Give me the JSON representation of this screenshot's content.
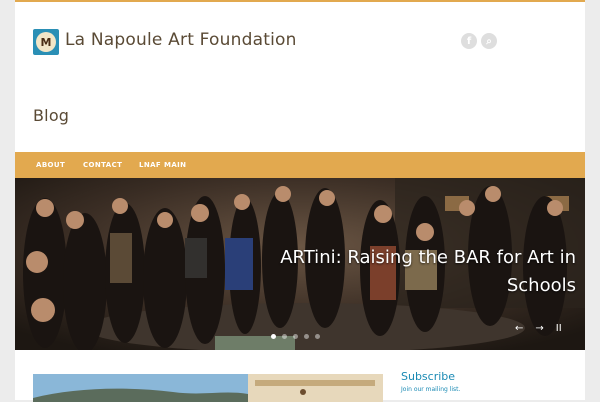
{
  "site": {
    "title": "La Napoule Art Foundation",
    "logo_letter": "M"
  },
  "header": {
    "page_heading": "Blog",
    "social_icons": [
      "facebook-icon",
      "search-icon"
    ]
  },
  "nav": {
    "items": [
      "ABOUT",
      "CONTACT",
      "LNAF MAIN"
    ]
  },
  "slider": {
    "title": "ARTini: Raising the BAR for Art in Schools",
    "dots": [
      true,
      false,
      false,
      false,
      false
    ],
    "controls": [
      "←",
      "→",
      "II"
    ]
  },
  "sidebar": {
    "subscribe_title": "Subscribe",
    "subscribe_text": "Join our mailing list."
  },
  "colors": {
    "accent": "#e2a94f",
    "link": "#1a8ab4",
    "title_text": "#5a4a35"
  }
}
